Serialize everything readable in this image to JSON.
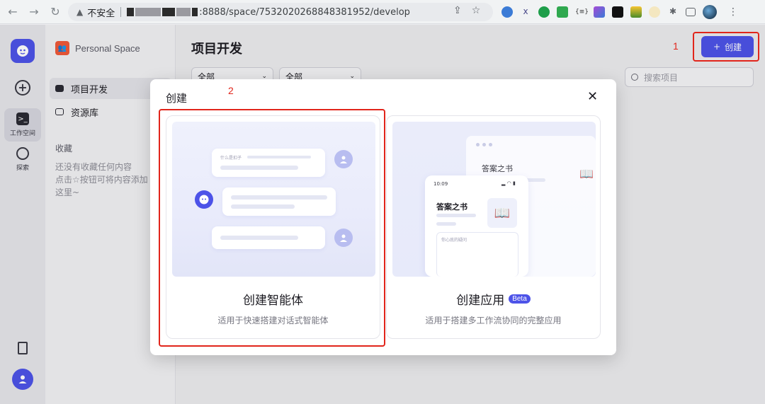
{
  "browser": {
    "insecure_label": "不安全",
    "url_suffix": ":8888/space/7532020268848381952/develop"
  },
  "rail": {
    "workspace_label": "工作空间",
    "explore_label": "探索"
  },
  "sidebar": {
    "space_name": "Personal Space",
    "items": [
      {
        "label": "项目开发"
      },
      {
        "label": "资源库"
      }
    ],
    "favorites_title": "收藏",
    "favorites_empty": "还没有收藏任何内容\n点击☆按钮可将内容添加\n这里~"
  },
  "main": {
    "title": "项目开发",
    "create_label": "创建",
    "filters": [
      "全部",
      "全部"
    ],
    "search_placeholder": "搜索项目"
  },
  "annotations": [
    "1",
    "2"
  ],
  "modal": {
    "title": "创建",
    "close": "✕",
    "cards": [
      {
        "title": "创建智能体",
        "subtitle": "适用于快速搭建对话式智能体",
        "illustration": {
          "question": "什么是扣子"
        }
      },
      {
        "title": "创建应用",
        "badge": "Beta",
        "subtitle": "适用于搭建多工作流协同的完整应用",
        "illustration": {
          "window_title": "答案之书",
          "phone_time": "10:09",
          "phone_title": "答案之书",
          "input_placeholder": "你心底的疑问"
        }
      }
    ]
  },
  "colors": {
    "accent": "#4d53e8",
    "highlight": "#e1251b"
  }
}
